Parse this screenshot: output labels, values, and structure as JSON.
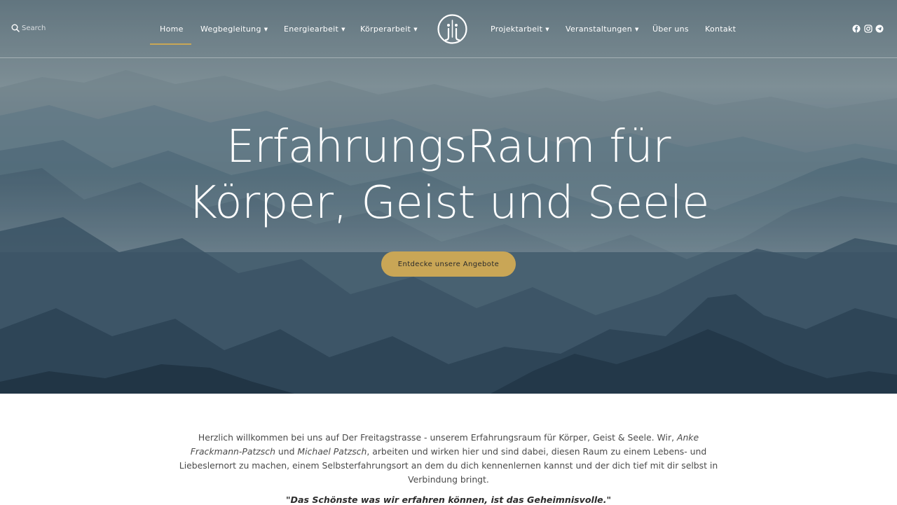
{
  "nav": {
    "search_placeholder": "Search",
    "items_left": [
      {
        "label": "Home",
        "dropdown": false,
        "active": true
      },
      {
        "label": "Wegbegleitung",
        "dropdown": true
      },
      {
        "label": "Energiearbeit",
        "dropdown": true
      },
      {
        "label": "Körperarbeit",
        "dropdown": true
      }
    ],
    "items_right": [
      {
        "label": "Projektarbeit",
        "dropdown": true
      },
      {
        "label": "Veranstaltungen",
        "dropdown": true
      },
      {
        "label": "Über uns",
        "dropdown": false
      },
      {
        "label": "Kontakt",
        "dropdown": false
      }
    ],
    "social_icons": [
      "facebook-icon",
      "instagram-icon",
      "telegram-icon"
    ]
  },
  "hero": {
    "headline_line1": "ErfahrungsRaum für",
    "headline_line2": "Körper, Geist und Seele",
    "cta_label": "Entdecke unsere Angebote"
  },
  "intro": {
    "part1": "Herzlich willkommen bei uns auf Der Freitagstrasse - unserem Erfahrungsraum für Körper, Geist & Seele. Wir, ",
    "name1": "Anke Frackmann-Patzsch",
    "part2": " und ",
    "name2": "Michael Patzsch",
    "part3": ", arbeiten und wirken hier und sind dabei, diesen Raum zu einem Lebens- und Liebeslernort zu machen, einem Selbsterfahrungsort an dem du dich kennenlernen kannst und der dich tief mit dir selbst in Verbindung bringt."
  },
  "quote": "\"Das Schönste was wir erfahren können, ist das Geheimnisvolle.\"",
  "colors": {
    "accent": "#c9a656",
    "text": "#4a4a4a",
    "nav_text": "#ffffff"
  }
}
